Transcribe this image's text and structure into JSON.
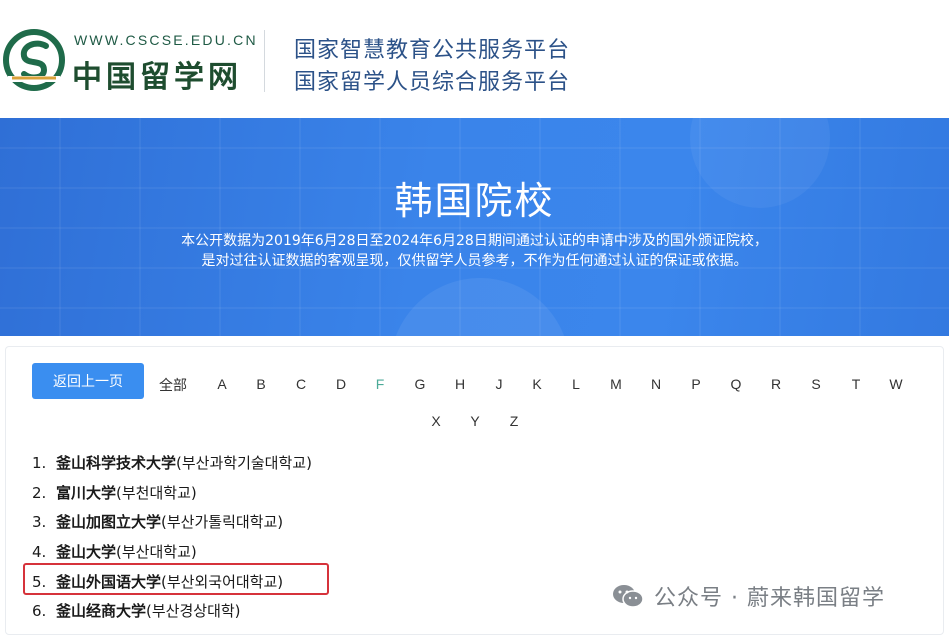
{
  "header": {
    "site_url": "WWW.CSCSE.EDU.CN",
    "site_name": "中国留学网",
    "platform_line1": "国家智慧教育公共服务平台",
    "platform_line2": "国家留学人员综合服务平台"
  },
  "banner": {
    "title": "韩国院校",
    "desc_line1": "本公开数据为2019年6月28日至2024年6月28日期间通过认证的申请中涉及的国外颁证院校，",
    "desc_line2": "是对过往认证数据的客观呈现，仅供留学人员参考，不作为任何通过认证的保证或依据。"
  },
  "filter": {
    "back_label": "返回上一页",
    "all_label": "全部",
    "letters": [
      "A",
      "B",
      "C",
      "D",
      "F",
      "G",
      "H",
      "J",
      "K",
      "L",
      "M",
      "N",
      "P",
      "Q",
      "R",
      "S",
      "T",
      "W",
      "X",
      "Y",
      "Z"
    ],
    "active_letter": "F"
  },
  "schools": [
    {
      "num": "1.",
      "name": "釜山科学技术大学",
      "korean": "(부산과학기술대학교)"
    },
    {
      "num": "2.",
      "name": "富川大学",
      "korean": "(부천대학교)"
    },
    {
      "num": "3.",
      "name": "釜山加图立大学",
      "korean": "(부산가톨릭대학교)"
    },
    {
      "num": "4.",
      "name": "釜山大学",
      "korean": "(부산대학교)"
    },
    {
      "num": "5.",
      "name": "釜山外国语大学",
      "korean": "(부산외국어대학교)"
    },
    {
      "num": "6.",
      "name": "釜山经商大学",
      "korean": "(부산경상대학)"
    }
  ],
  "highlighted_index": 4,
  "watermark": {
    "text": "公众号 · 蔚来韩国留学",
    "icon": "wechat-icon"
  },
  "colors": {
    "banner": "#3a84ea",
    "button": "#3a8ef0",
    "highlight": "#d6333b",
    "active_letter": "#4caa98",
    "platform_text": "#2c5288"
  }
}
